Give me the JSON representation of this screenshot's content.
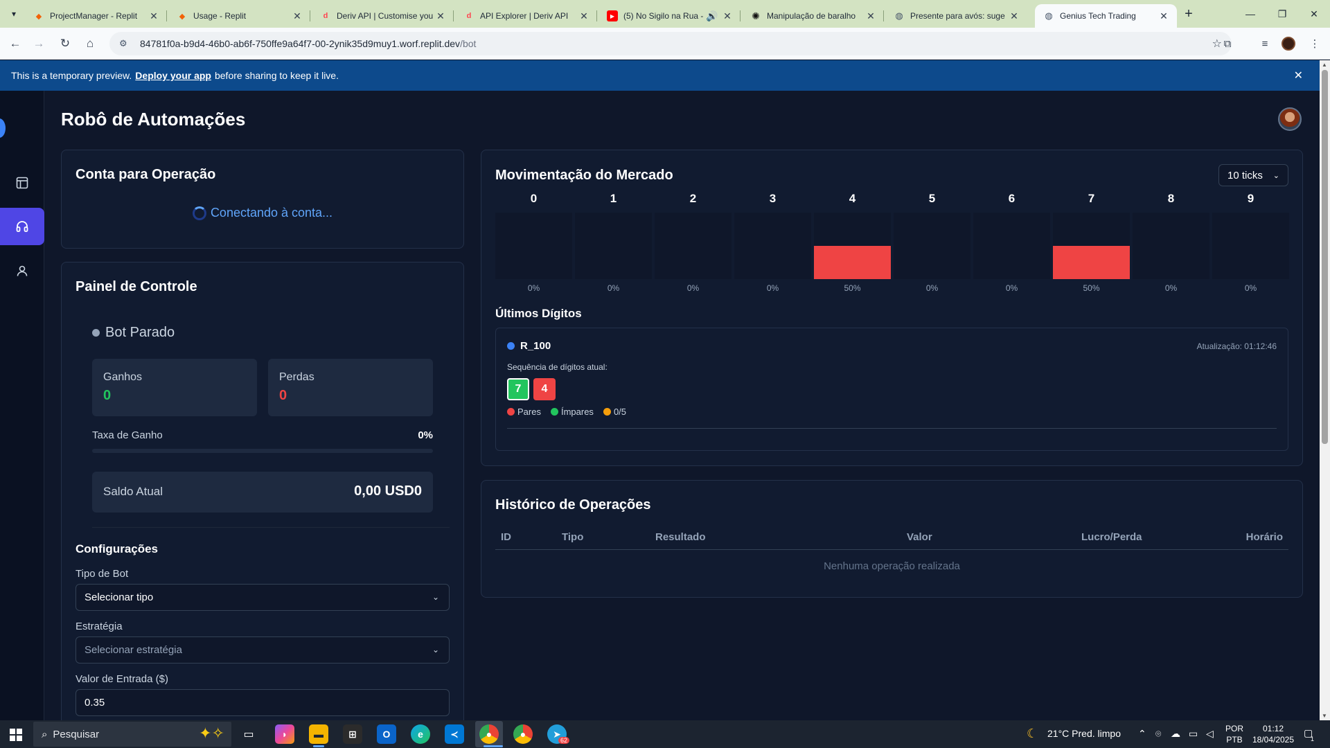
{
  "browser": {
    "tabs": [
      {
        "title": "ProjectManager - Replit",
        "icon": "replit-icon",
        "color": "#f26207"
      },
      {
        "title": "Usage - Replit",
        "icon": "replit-icon",
        "color": "#f26207"
      },
      {
        "title": "Deriv API | Customise you",
        "icon": "deriv-icon",
        "color": "#ff444f"
      },
      {
        "title": "API Explorer | Deriv API",
        "icon": "deriv-icon",
        "color": "#ff444f"
      },
      {
        "title": "(5) No Sigilo na Rua -",
        "icon": "youtube-icon",
        "color": "#ff0000"
      },
      {
        "title": "Manipulação de baralho",
        "icon": "chatgpt-icon",
        "color": "#111111"
      },
      {
        "title": "Presente para avós: suge",
        "icon": "globe-icon",
        "color": "#475569"
      },
      {
        "title": "Genius Tech Trading",
        "icon": "globe-icon",
        "color": "#475569"
      }
    ],
    "url_host": "84781f0a-b9d4-46b0-ab6f-750ffe9a64f7-00-2ynik35d9muy1.worf.replit.dev",
    "url_path": "/bot"
  },
  "banner": {
    "text_before": "This is a temporary preview.",
    "link": "Deploy your app",
    "text_after": "before sharing to keep it live."
  },
  "app": {
    "title": "Robô de Automações",
    "account": {
      "title": "Conta para Operação",
      "status": "Conectando à conta..."
    },
    "control": {
      "title": "Painel de Controle",
      "bot_status": "Bot Parado",
      "gains_label": "Ganhos",
      "gains_value": "0",
      "losses_label": "Perdas",
      "losses_value": "0",
      "win_rate_label": "Taxa de Ganho",
      "win_rate_value": "0%",
      "balance_label": "Saldo Atual",
      "balance_value": "0,00 USD0",
      "config_title": "Configurações",
      "bot_type_label": "Tipo de Bot",
      "bot_type_value": "Selecionar tipo",
      "strategy_label": "Estratégia",
      "strategy_value": "Selecionar estratégia",
      "entry_label": "Valor de Entrada ($)",
      "entry_value": "0.35"
    },
    "market": {
      "title": "Movimentação do Mercado",
      "ticks_value": "10 ticks",
      "digits": [
        {
          "digit": "0",
          "pct": "0%",
          "share": 0
        },
        {
          "digit": "1",
          "pct": "0%",
          "share": 0
        },
        {
          "digit": "2",
          "pct": "0%",
          "share": 0
        },
        {
          "digit": "3",
          "pct": "0%",
          "share": 0
        },
        {
          "digit": "4",
          "pct": "50%",
          "share": 0.5
        },
        {
          "digit": "5",
          "pct": "0%",
          "share": 0
        },
        {
          "digit": "6",
          "pct": "0%",
          "share": 0
        },
        {
          "digit": "7",
          "pct": "50%",
          "share": 0.5
        },
        {
          "digit": "8",
          "pct": "0%",
          "share": 0
        },
        {
          "digit": "9",
          "pct": "0%",
          "share": 0
        }
      ],
      "bar_color": "#ef4444",
      "last_digits_title": "Últimos Dígitos",
      "symbol": "R_100",
      "updated": "Atualização: 01:12:46",
      "sequence_label": "Sequência de dígitos atual:",
      "sequence": [
        {
          "value": "7",
          "parity": "odd"
        },
        {
          "value": "4",
          "parity": "even"
        }
      ],
      "legend_even": "Pares",
      "legend_odd": "Ímpares",
      "legend_count": "0/5"
    },
    "history": {
      "title": "Histórico de Operações",
      "columns": [
        "ID",
        "Tipo",
        "Resultado",
        "Valor",
        "Lucro/Perda",
        "Horário"
      ],
      "empty": "Nenhuma operação realizada"
    }
  },
  "taskbar": {
    "search_placeholder": "Pesquisar",
    "weather": "21°C  Pred. limpo",
    "lang_top": "POR",
    "lang_bottom": "PTB",
    "time": "01:12",
    "date": "18/04/2025",
    "telegram_badge": "62",
    "notification_count": "1"
  }
}
